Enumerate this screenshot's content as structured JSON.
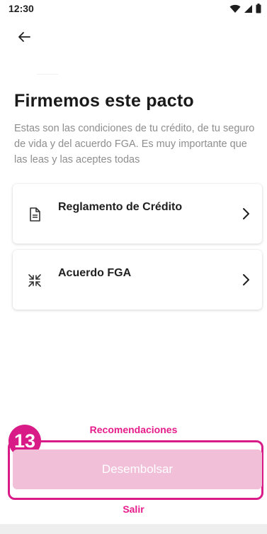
{
  "status_bar": {
    "time": "12:30",
    "icons": [
      "wifi-icon",
      "signal-icon",
      "battery-icon"
    ]
  },
  "header": {
    "back_icon": "arrow-left-icon"
  },
  "main": {
    "title": "Firmemos este pacto",
    "subtitle": "Estas son las condiciones de tu crédito, de tu seguro de vida y del acuerdo FGA. Es muy importante que las leas y las aceptes todas",
    "cards": [
      {
        "label": "Reglamento de Crédito",
        "icon": "document-icon"
      },
      {
        "label": "Acuerdo FGA",
        "icon": "compress-arrows-icon"
      }
    ]
  },
  "footer": {
    "recommendations_label": "Recomendaciones",
    "step_badge": "13",
    "disburse_label": "Desembolsar",
    "exit_label": "Salir"
  },
  "colors": {
    "accent": "#e61c8a",
    "highlight": "#d81b87",
    "button_disabled": "#f1bfd8",
    "subtitle": "#8e8e8e"
  }
}
